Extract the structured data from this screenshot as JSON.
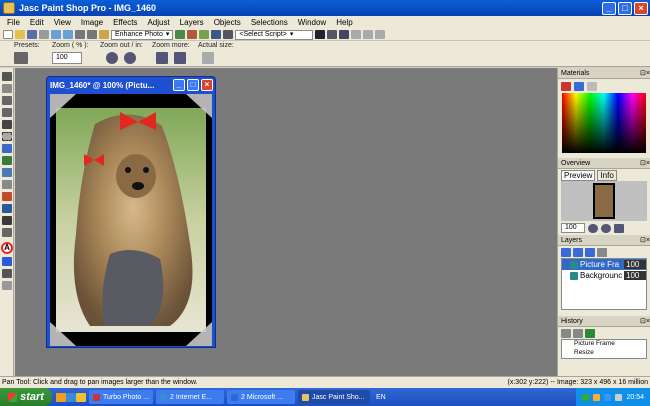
{
  "window": {
    "title": "Jasc Paint Shop Pro - IMG_1460"
  },
  "menu": [
    "File",
    "Edit",
    "View",
    "Image",
    "Effects",
    "Adjust",
    "Layers",
    "Objects",
    "Selections",
    "Window",
    "Help"
  ],
  "toolbar": {
    "enhance_label": "Enhance Photo",
    "script_value": "<Select Script>"
  },
  "tool_options": {
    "presets_label": "Presets:",
    "zoom_pct_label": "Zoom ( % ):",
    "zoom_value": "100",
    "zoom_out_in_label": "Zoom out / in:",
    "zoom_more_label": "Zoom more:",
    "actual_size_label": "Actual size:"
  },
  "document": {
    "title": "IMG_1460* @ 100% (Pictu..."
  },
  "panels": {
    "materials_title": "Materials",
    "overview_title": "Overview",
    "preview_tab": "Preview",
    "info_tab": "Info",
    "overview_zoom": "100",
    "layers_title": "Layers",
    "layers": [
      {
        "name": "Picture Fra",
        "opacity": "100"
      },
      {
        "name": "Backgrounc",
        "opacity": "100"
      }
    ],
    "history_title": "History",
    "history": [
      "Picture Frame",
      "Resize"
    ]
  },
  "status": {
    "message": "Pan Tool: Click and drag to pan images larger than the window.",
    "coords": "(x:302 y:222) -- Image:  323 x 496 x 16 million"
  },
  "taskbar": {
    "start_label": "start",
    "tasks": [
      "Turbo Photo ...",
      "2 Internet E...",
      "2 Microsoft ...",
      "Jasc Paint Sho..."
    ],
    "lang": "EN",
    "clock": "20:54"
  },
  "colors": {
    "title_blue": "#0842b3",
    "workspace": "#7a7a7a",
    "start_green": "#2a7c2a"
  }
}
